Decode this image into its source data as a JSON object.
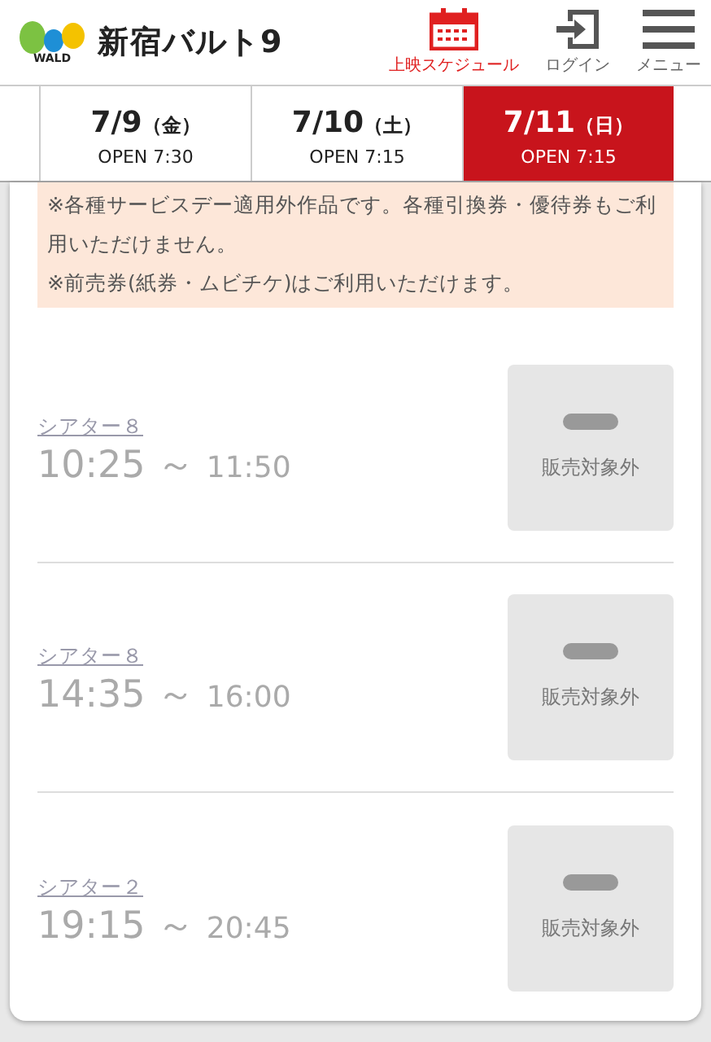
{
  "header": {
    "logo_mark": "WALD",
    "site_name": "新宿バルト9",
    "nav": [
      {
        "kind": "calendar",
        "label": "上映スケジュール",
        "selected": true
      },
      {
        "kind": "login",
        "label": "ログイン",
        "selected": false
      },
      {
        "kind": "menu",
        "label": "メニュー",
        "selected": false
      }
    ]
  },
  "date_tabs": [
    {
      "date": "7/9",
      "weekday": "（金）",
      "open": "OPEN 7:30",
      "selected": false
    },
    {
      "date": "7/10",
      "weekday": "（土）",
      "open": "OPEN 7:15",
      "selected": false
    },
    {
      "date": "7/11",
      "weekday": "（日）",
      "open": "OPEN 7:15",
      "selected": true
    }
  ],
  "notice": [
    "※各種サービスデー適用外作品です。各種引換券・優待券もご利用いただけません。",
    "※前売券(紙券・ムビチケ)はご利用いただけます。"
  ],
  "showings": [
    {
      "theater": "シアター８",
      "start": "10:25",
      "end": "11:50",
      "tilde": "～",
      "status": "販売対象外",
      "available": false
    },
    {
      "theater": "シアター８",
      "start": "14:35",
      "end": "16:00",
      "tilde": "～",
      "status": "販売対象外",
      "available": false
    },
    {
      "theater": "シアター２",
      "start": "19:15",
      "end": "20:45",
      "tilde": "～",
      "status": "販売対象外",
      "available": false
    }
  ]
}
